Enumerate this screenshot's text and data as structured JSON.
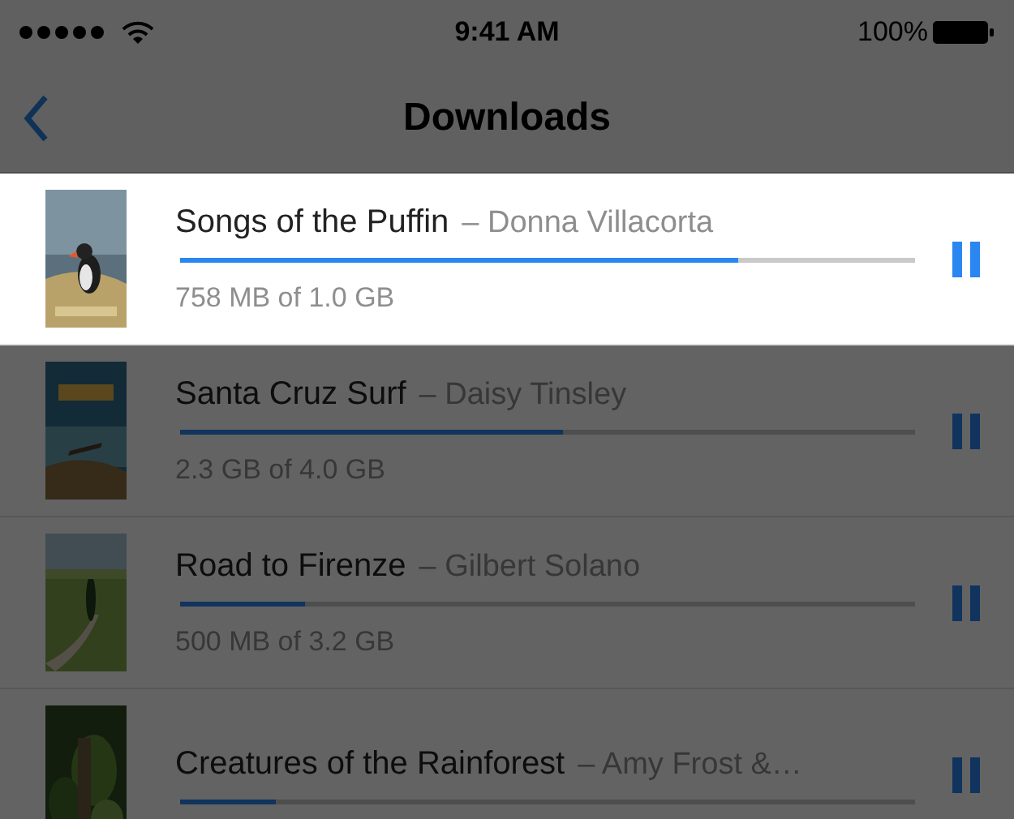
{
  "status_bar": {
    "time": "9:41 AM",
    "battery": "100%"
  },
  "nav": {
    "title": "Downloads"
  },
  "downloads": [
    {
      "title": "Songs of the Puffin",
      "author": "– Donna Villacorta",
      "level": 0.76,
      "size": "758 MB of 1.0 GB",
      "highlighted": true
    },
    {
      "title": "Santa Cruz Surf",
      "author": "– Daisy Tinsley",
      "level": 0.52,
      "size": "2.3 GB of 4.0 GB",
      "highlighted": false
    },
    {
      "title": "Road to Firenze",
      "author": "– Gilbert Solano",
      "level": 0.17,
      "size": "500 MB of 3.2 GB",
      "highlighted": false
    },
    {
      "title": "Creatures of the Rainforest",
      "author": "– Amy Frost &…",
      "level": 0.13,
      "highlighted": false
    }
  ]
}
